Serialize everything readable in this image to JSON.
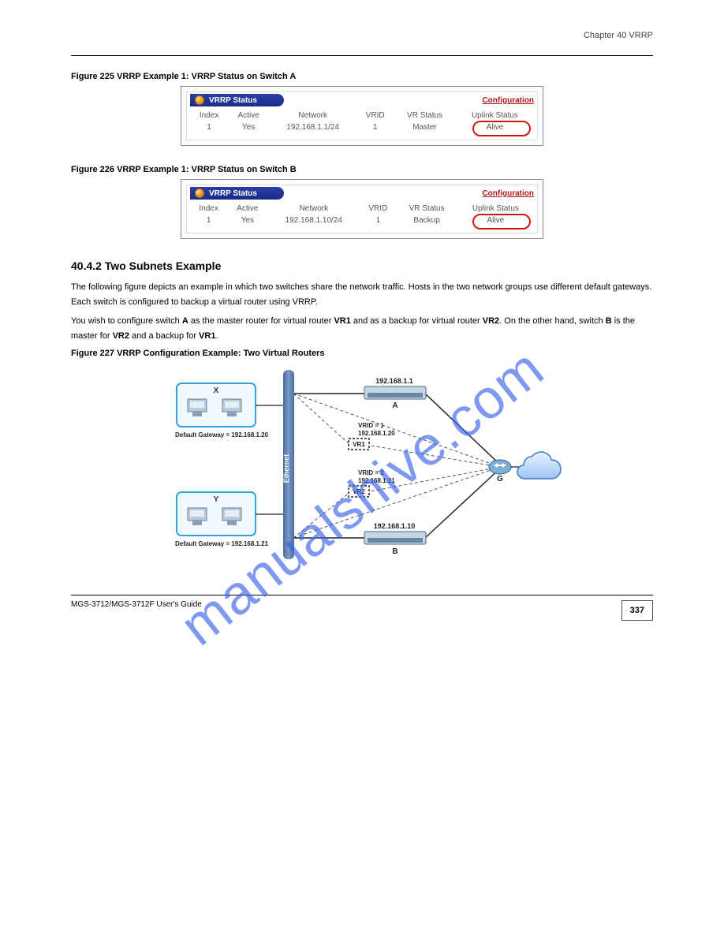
{
  "header": {
    "chapter": "Chapter 40 VRRP"
  },
  "fig1": {
    "label": "Figure 225   VRRP Example 1: VRRP Status on Switch A",
    "title": "VRRP Status",
    "config_link": "Configuration",
    "headers": [
      "Index",
      "Active",
      "Network",
      "VRID",
      "VR Status",
      "Uplink Status"
    ],
    "row": {
      "index": "1",
      "active": "Yes",
      "network": "192.168.1.1/24",
      "vrid": "1",
      "vrstatus": "Master",
      "uplink": "Alive"
    }
  },
  "fig2": {
    "label": "Figure 226   VRRP Example 1: VRRP Status on Switch B",
    "title": "VRRP Status",
    "config_link": "Configuration",
    "headers": [
      "Index",
      "Active",
      "Network",
      "VRID",
      "VR Status",
      "Uplink Status"
    ],
    "row": {
      "index": "1",
      "active": "Yes",
      "network": "192.168.1.10/24",
      "vrid": "1",
      "vrstatus": "Backup",
      "uplink": "Alive"
    }
  },
  "section": {
    "heading": "40.4.2  Two Subnets Example",
    "p1a": "The following figure depicts an example in which two switches share the network traffic. Hosts in the two network groups use different default gateways. Each switch is configured to backup a virtual router using VRRP.",
    "p2a": "You wish to configure switch ",
    "p2b": "A",
    "p2c": " as the master router for virtual router ",
    "p2d": "VR1",
    "p2e": " and as a backup for virtual router ",
    "p2f": "VR2",
    "p2g": ". On the other hand, switch ",
    "p2h": "B",
    "p2i": " is the master for ",
    "p2j": "VR2",
    "p2k": " and a backup for ",
    "p2l": "VR1",
    "p2m": "."
  },
  "fig3": {
    "label": "Figure 227   VRRP Configuration Example: Two Virtual Routers"
  },
  "diagram": {
    "x_label": "X",
    "y_label": "Y",
    "gw_x": "Default Gateway = 192.168.1.20",
    "gw_y": "Default Gateway = 192.168.1.21",
    "ethernet": "Ethernet",
    "a_ip": "192.168.1.1",
    "a_label": "A",
    "vr1_text": "VRID = 1\n192.168.1.20",
    "vr1_box": "VR1",
    "vr2_text": "VRID = 2\n192.168.1.21",
    "vr2_box": "VR2",
    "b_ip": "192.168.1.10",
    "b_label": "B",
    "g_label": "G"
  },
  "footer": {
    "guide": "MGS-3712/MGS-3712F User's Guide",
    "page": "337"
  },
  "watermark": "manualshive.com"
}
